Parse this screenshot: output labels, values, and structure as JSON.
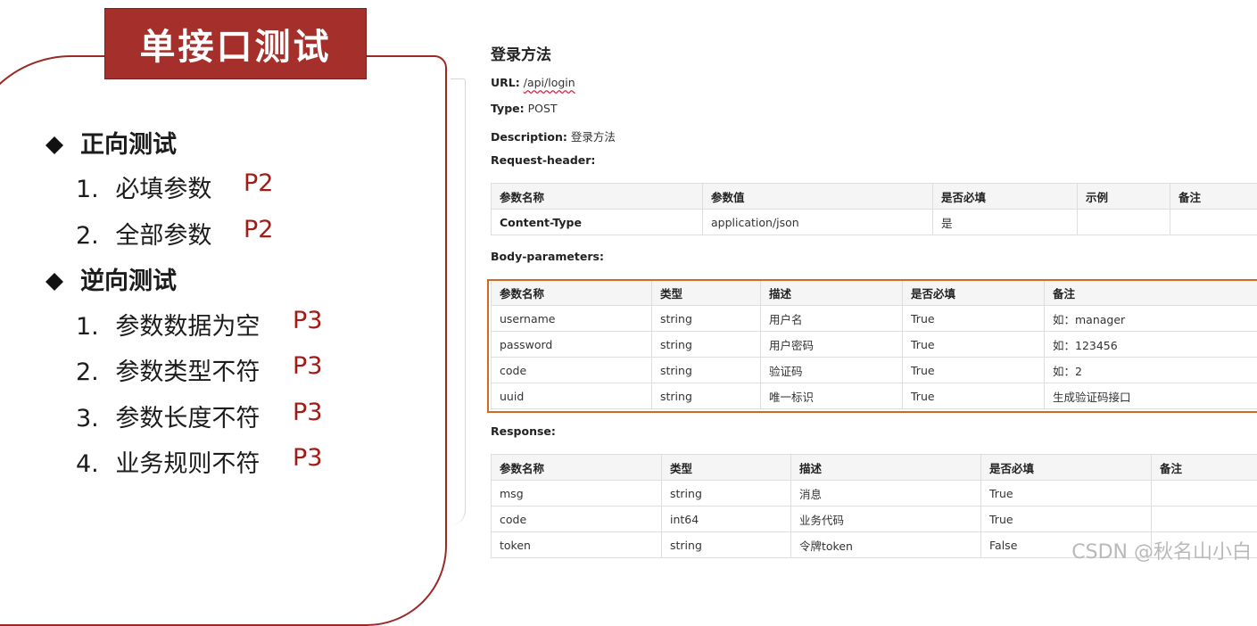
{
  "slide": {
    "title": "单接口测试",
    "sections": [
      {
        "heading": "正向测试",
        "items": [
          {
            "num": "1.",
            "label": "必填参数",
            "priority": "P2"
          },
          {
            "num": "2.",
            "label": "全部参数",
            "priority": "P2"
          }
        ]
      },
      {
        "heading": "逆向测试",
        "items": [
          {
            "num": "1.",
            "label": "参数数据为空",
            "priority": "P3"
          },
          {
            "num": "2.",
            "label": "参数类型不符",
            "priority": "P3"
          },
          {
            "num": "3.",
            "label": "参数长度不符",
            "priority": "P3"
          },
          {
            "num": "4.",
            "label": "业务规则不符",
            "priority": "P3"
          }
        ]
      }
    ],
    "accent_color": "#a52f2b"
  },
  "doc": {
    "title": "登录方法",
    "url_label": "URL:",
    "url_value": "/api/login",
    "type_label": "Type:",
    "type_value": "POST",
    "desc_label": "Description:",
    "desc_value": "登录方法",
    "request_header_label": "Request-header:",
    "request_header_table": {
      "headers": [
        "参数名称",
        "参数值",
        "是否必填",
        "示例",
        "备注"
      ],
      "rows": [
        [
          "Content-Type",
          "application/json",
          "是",
          "",
          ""
        ]
      ]
    },
    "body_label": "Body-parameters:",
    "body_table": {
      "headers": [
        "参数名称",
        "类型",
        "描述",
        "是否必填",
        "备注"
      ],
      "rows": [
        [
          "username",
          "string",
          "用户名",
          "True",
          "如：manager"
        ],
        [
          "password",
          "string",
          "用户密码",
          "True",
          "如：123456"
        ],
        [
          "code",
          "string",
          "验证码",
          "True",
          "如：2"
        ],
        [
          "uuid",
          "string",
          "唯一标识",
          "True",
          "生成验证码接口"
        ]
      ]
    },
    "response_label": "Response:",
    "response_table": {
      "headers": [
        "参数名称",
        "类型",
        "描述",
        "是否必填",
        "备注"
      ],
      "rows": [
        [
          "msg",
          "string",
          "消息",
          "True",
          ""
        ],
        [
          "code",
          "int64",
          "业务代码",
          "True",
          ""
        ],
        [
          "token",
          "string",
          "令牌token",
          "False",
          ""
        ]
      ]
    }
  },
  "watermark": "CSDN @秋名山小白"
}
